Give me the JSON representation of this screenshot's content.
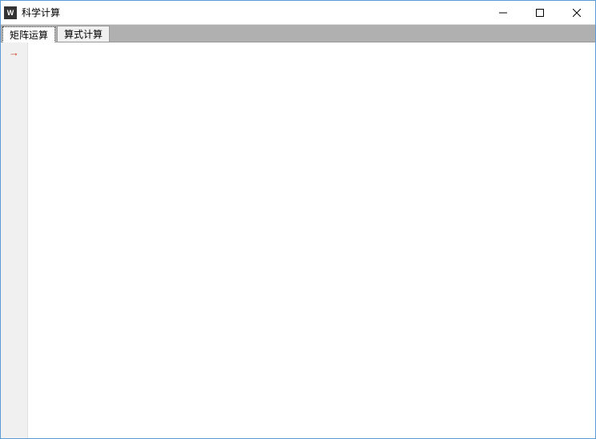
{
  "window": {
    "title": "科学计算",
    "app_icon_glyph": "W"
  },
  "tabs": [
    {
      "label": "矩阵运算",
      "active": true
    },
    {
      "label": "算式计算",
      "active": false
    }
  ],
  "gutter": {
    "prompt_glyph": "→"
  },
  "editor": {
    "value": ""
  }
}
